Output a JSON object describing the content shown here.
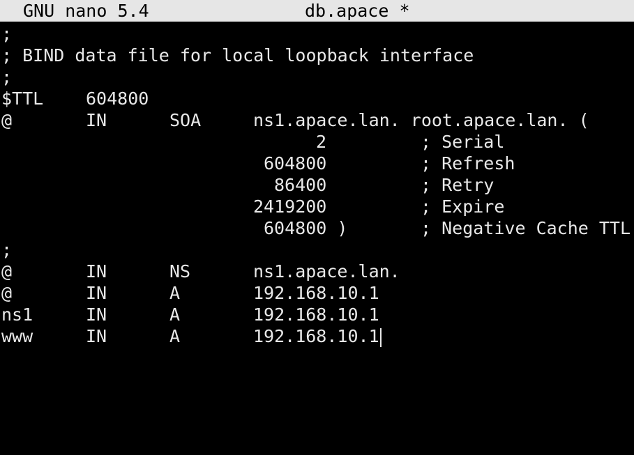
{
  "titlebar": {
    "app": "GNU nano 5.4",
    "filename": "db.apace *"
  },
  "lines": {
    "l1": ";",
    "l2": "; BIND data file for local loopback interface",
    "l3": ";",
    "ttl_label": "$TTL",
    "ttl_value": "604800",
    "soa_name": "@",
    "soa_class": "IN",
    "soa_type": "SOA",
    "soa_data": "ns1.apace.lan. root.apace.lan. (",
    "serial_value": "2",
    "serial_comment": "; Serial",
    "refresh_value": "604800",
    "refresh_comment": "; Refresh",
    "retry_value": "86400",
    "retry_comment": "; Retry",
    "expire_value": "2419200",
    "expire_comment": "; Expire",
    "neg_value": "604800 )",
    "neg_comment": "; Negative Cache TTL",
    "l12": ";",
    "r1_name": "@",
    "r1_class": "IN",
    "r1_type": "NS",
    "r1_data": "ns1.apace.lan.",
    "r2_name": "@",
    "r2_class": "IN",
    "r2_type": "A",
    "r2_data": "192.168.10.1",
    "r3_name": "ns1",
    "r3_class": "IN",
    "r3_type": "A",
    "r3_data": "192.168.10.1",
    "r4_name": "www",
    "r4_class": "IN",
    "r4_type": "A",
    "r4_data": "192.168.10.1"
  }
}
